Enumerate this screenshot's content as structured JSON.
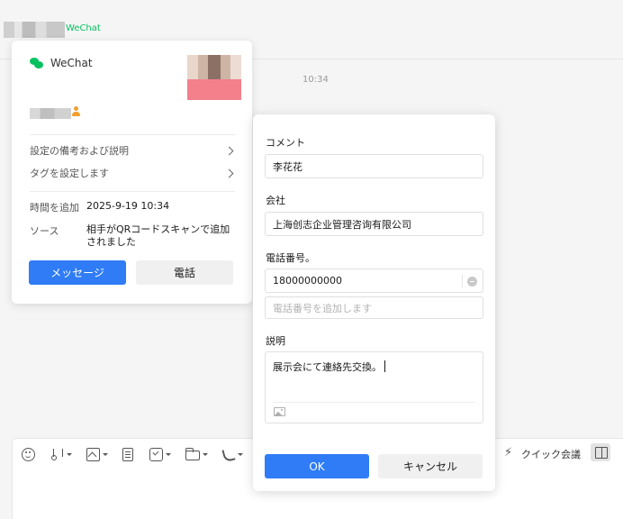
{
  "chat_header": {
    "wechat_tag": "WeChat"
  },
  "timestamp": "10:34",
  "profile_card": {
    "brand_label": "WeChat",
    "menu": [
      {
        "label": "設定の備考および説明"
      },
      {
        "label": "タグを設定します"
      }
    ],
    "info": [
      {
        "label": "時間を追加",
        "value": "2025-9-19 10:34"
      },
      {
        "label": "ソース",
        "value": "相手がQRコードスキャンで追加されました"
      }
    ],
    "message_button": "メッセージ",
    "call_button": "電話"
  },
  "edit_dialog": {
    "comment_label": "コメント",
    "comment_value": "李花花",
    "company_label": "会社",
    "company_value": "上海创志企业管理咨询有限公司",
    "phone_label": "電話番号。",
    "phone_value": "18000000000",
    "phone_add_placeholder": "電話番号を追加します",
    "description_label": "説明",
    "description_value": "展示会にて連絡先交換。",
    "ok_button": "OK",
    "cancel_button": "キャンセル"
  },
  "toolbar": {
    "quick_meeting_label": "クイック会議"
  },
  "icons": [
    "emoji-icon",
    "scissors-icon",
    "picture-icon",
    "document-icon",
    "checkbox-icon",
    "folder-icon",
    "phone-icon",
    "lightning-icon",
    "side-panel-icon",
    "image-icon",
    "remove-icon",
    "chevron-right-icon",
    "wechat-logo-icon"
  ],
  "colors": {
    "accent_blue": "#2f7cf6",
    "wechat_green": "#07c160"
  }
}
